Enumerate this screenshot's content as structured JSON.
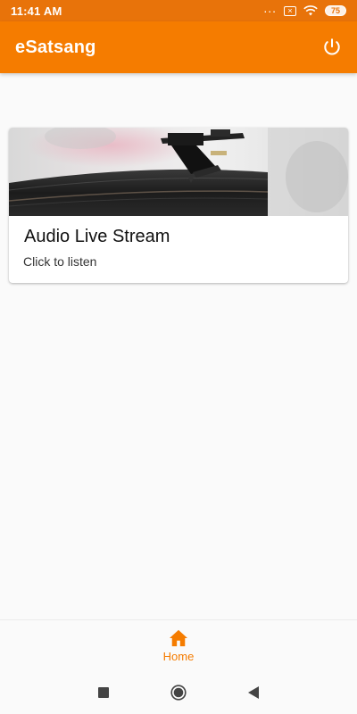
{
  "status_bar": {
    "time": "11:41 AM",
    "overflow": "...",
    "sim_mark": "×",
    "battery": "75",
    "color": "#e8730a"
  },
  "app_bar": {
    "title": "eSatsang",
    "power_icon": "power-icon",
    "color": "#f57c00"
  },
  "card": {
    "image": "turntable-record-image",
    "title": "Audio Live Stream",
    "subtitle": "Click to listen"
  },
  "bottom_nav": {
    "items": [
      {
        "label": "Home",
        "icon": "home-icon",
        "active": true
      }
    ],
    "active_color": "#f57c00"
  },
  "system_nav": {
    "icons": [
      "recents-square-icon",
      "home-circle-icon",
      "back-triangle-icon"
    ]
  }
}
